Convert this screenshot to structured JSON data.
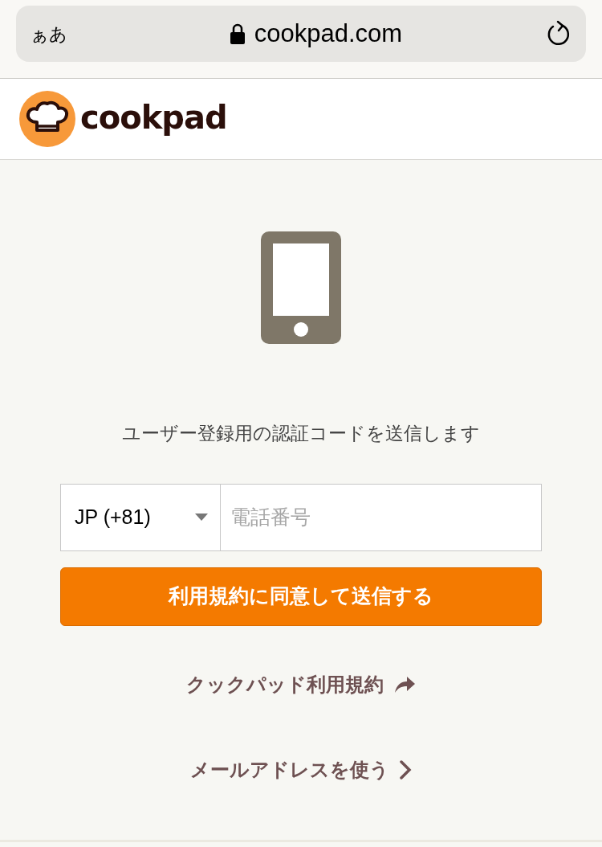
{
  "browser_bar": {
    "text_size_button": "ぁあ",
    "url": "cookpad.com"
  },
  "header": {
    "logo_text": "cookpad"
  },
  "message": "ユーザー登録用の認証コードを送信します",
  "phone_form": {
    "country": "JP (+81)",
    "phone_placeholder": "電話番号",
    "submit": "利用規約に同意して送信する"
  },
  "links": [
    {
      "kind": "external",
      "label": "クックパッド利用規約"
    },
    {
      "kind": "next",
      "label": "メールアドレスを使う"
    }
  ]
}
